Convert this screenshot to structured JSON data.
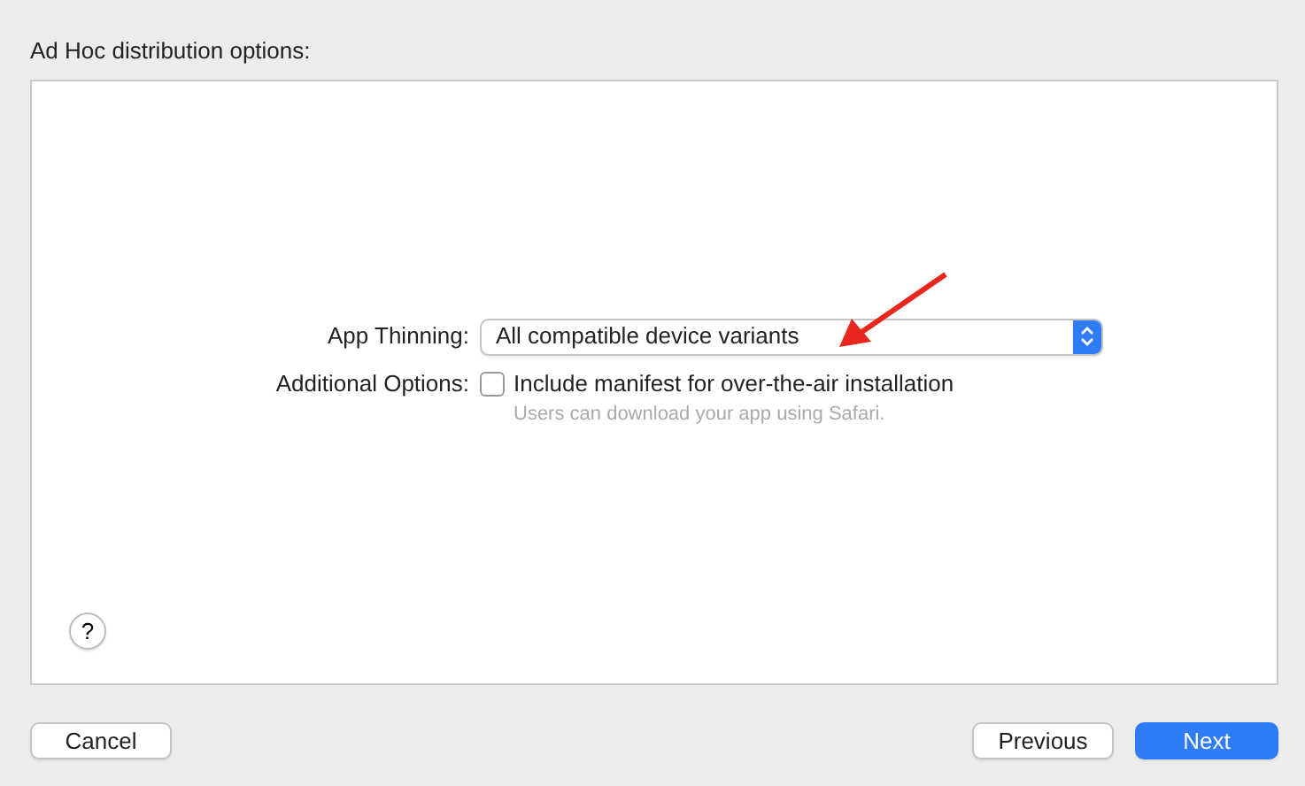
{
  "heading": "Ad Hoc distribution options:",
  "options": [
    {
      "kind": "select",
      "label": "App Thinning:",
      "value": "All compatible device variants"
    },
    {
      "kind": "checkbox",
      "label": "Additional Options:",
      "text": "Include manifest for over-the-air installation",
      "checked": false,
      "hint": "Users can download your app using Safari."
    }
  ],
  "help_button": "?",
  "buttons": [
    {
      "label": "Cancel",
      "kind": "default"
    },
    {
      "label": "Previous",
      "kind": "default"
    },
    {
      "label": "Next",
      "kind": "primary"
    }
  ]
}
